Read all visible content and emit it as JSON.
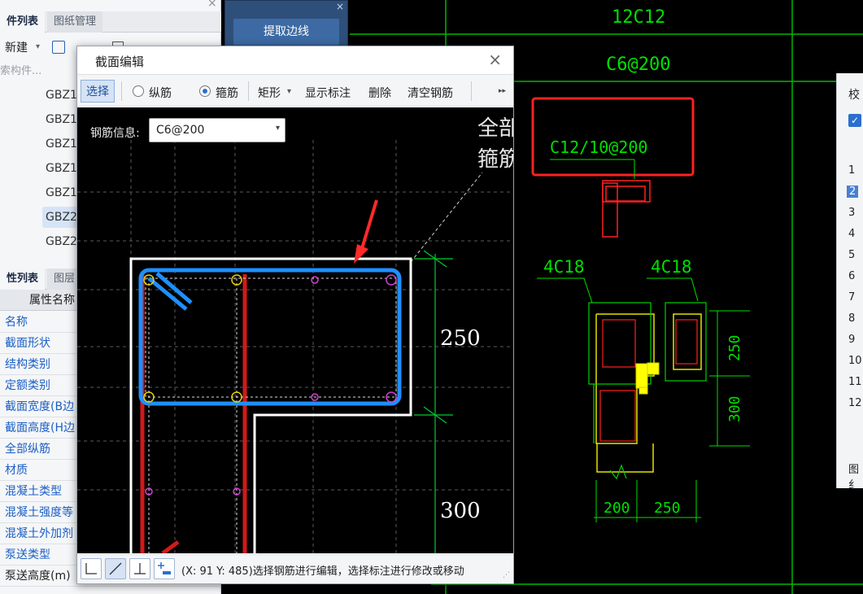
{
  "left_panel": {
    "tabs": [
      "件列表",
      "图纸管理"
    ],
    "toolbar": {
      "new_label": "新建",
      "new_caret": "▾"
    },
    "search_placeholder": "索构件...",
    "components": [
      "GBZ1",
      "GBZ1",
      "GBZ1",
      "GBZ1",
      "GBZ1",
      "GBZ2",
      "GBZ2"
    ],
    "prop_tabs": [
      "性列表",
      "图层"
    ],
    "prop_header": "属性名称",
    "props": [
      "名称",
      "截面形状",
      "结构类别",
      "定额类别",
      "截面宽度(B边",
      "截面高度(H边",
      "全部纵筋",
      "材质",
      "混凝土类型",
      "混凝土强度等",
      "混凝土外加剂",
      "泵送类型",
      "泵送高度(m)"
    ],
    "close_glyph": "×"
  },
  "extract_panel": {
    "button": "提取边线",
    "close_glyph": "×"
  },
  "right_panel": {
    "title": "校",
    "rows": [
      "1",
      "2",
      "3",
      "4",
      "5",
      "6",
      "7",
      "8",
      "9",
      "10",
      "11",
      "12"
    ],
    "footer": "图纟"
  },
  "cad": {
    "labels": {
      "top1": "12C12",
      "top2": "C6@200",
      "stirrup": "C12/10@200",
      "left_bar": "4C18",
      "right_bar": "4C18",
      "dim_250_v": "250",
      "dim_300_v": "300",
      "dim_200_h": "200",
      "dim_250_h": "250"
    },
    "colors": {
      "grid": "#00c000",
      "red_box": "#ff2020",
      "yellow": "#e8e000",
      "cad_text": "#00e000"
    }
  },
  "dialog": {
    "title": "截面编辑",
    "close_glyph": "×",
    "toolbar": {
      "select": "选择",
      "longitudinal": "纵筋",
      "stirrup": "箍筋",
      "shape": "矩形",
      "shape_caret": "▾",
      "show_annot": "显示标注",
      "delete": "删除",
      "clear": "清空钢筋",
      "more": "▸▸"
    },
    "rebar_info_label": "钢筋信息:",
    "rebar_info_value": "C6@200",
    "canvas": {
      "annotation_text1": "全部",
      "annotation_text2": "箍筋",
      "dim_250": "250",
      "dim_300": "300"
    },
    "status_text": "(X: 91 Y: 485)选择钢筋进行编辑，选择标注进行修改或移动",
    "colors": {
      "stirrup_blue": "#1e8fff",
      "section_white": "#ffffff",
      "long_red": "#d01a1a",
      "arrow_red": "#ff2a2a"
    }
  }
}
